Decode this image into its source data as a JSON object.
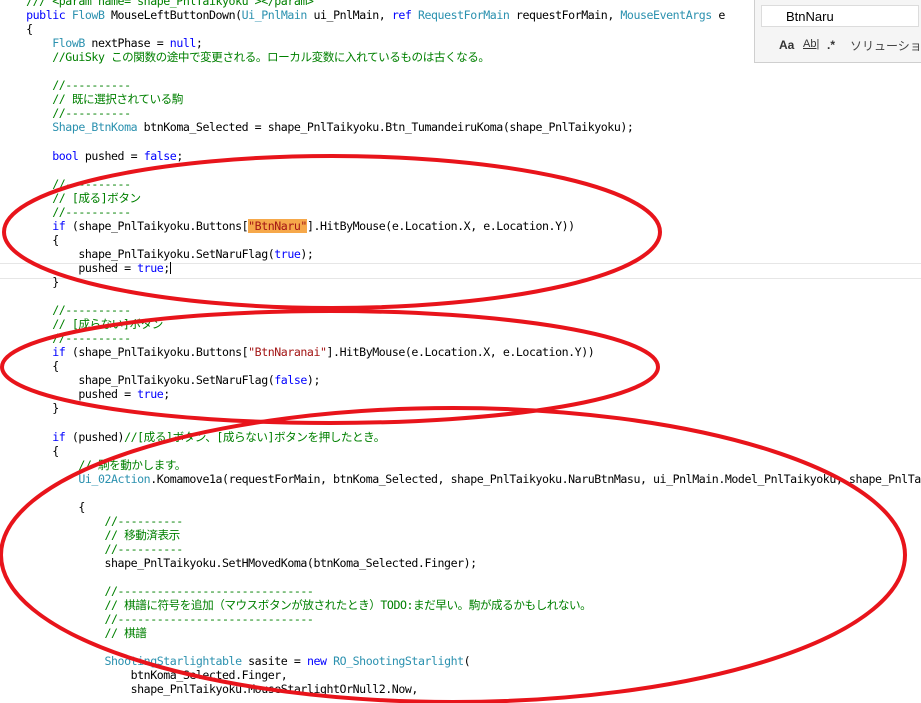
{
  "editor": {
    "lines": [
      [
        {
          "t": "    /// <param name=\"shape_PnlTaikyoku\"></param>",
          "c": "comment"
        }
      ],
      [
        {
          "t": "    ",
          "c": "plain"
        },
        {
          "t": "public",
          "c": "kw"
        },
        {
          "t": " ",
          "c": "plain"
        },
        {
          "t": "FlowB",
          "c": "type"
        },
        {
          "t": " MouseLeftButtonDown(",
          "c": "plain"
        },
        {
          "t": "Ui_PnlMain",
          "c": "type"
        },
        {
          "t": " ui_PnlMain, ",
          "c": "plain"
        },
        {
          "t": "ref",
          "c": "kw"
        },
        {
          "t": " ",
          "c": "plain"
        },
        {
          "t": "RequestForMain",
          "c": "type"
        },
        {
          "t": " requestForMain, ",
          "c": "plain"
        },
        {
          "t": "MouseEventArgs",
          "c": "type"
        },
        {
          "t": " e",
          "c": "plain"
        }
      ],
      [
        {
          "t": "    {",
          "c": "plain"
        }
      ],
      [
        {
          "t": "        ",
          "c": "plain"
        },
        {
          "t": "FlowB",
          "c": "type"
        },
        {
          "t": " nextPhase = ",
          "c": "plain"
        },
        {
          "t": "null",
          "c": "kw"
        },
        {
          "t": ";",
          "c": "plain"
        }
      ],
      [
        {
          "t": "        //GuiSky この関数の途中で変更される。ローカル変数に入れているものは古くなる。",
          "c": "comment"
        }
      ],
      [],
      [
        {
          "t": "        //----------",
          "c": "comment"
        }
      ],
      [
        {
          "t": "        // 既に選択されている駒",
          "c": "comment"
        }
      ],
      [
        {
          "t": "        //----------",
          "c": "comment"
        }
      ],
      [
        {
          "t": "        ",
          "c": "plain"
        },
        {
          "t": "Shape_BtnKoma",
          "c": "type"
        },
        {
          "t": " btnKoma_Selected = shape_PnlTaikyoku.Btn_TumandeiruKoma(shape_PnlTaikyoku);",
          "c": "plain"
        }
      ],
      [],
      [
        {
          "t": "        ",
          "c": "plain"
        },
        {
          "t": "bool",
          "c": "kw"
        },
        {
          "t": " pushed = ",
          "c": "plain"
        },
        {
          "t": "false",
          "c": "kw"
        },
        {
          "t": ";",
          "c": "plain"
        }
      ],
      [],
      [
        {
          "t": "        //----------",
          "c": "comment"
        }
      ],
      [
        {
          "t": "        // [成る]ボタン",
          "c": "comment"
        }
      ],
      [
        {
          "t": "        //----------",
          "c": "comment"
        }
      ],
      [
        {
          "t": "        ",
          "c": "plain"
        },
        {
          "t": "if",
          "c": "kw"
        },
        {
          "t": " (shape_PnlTaikyoku.Buttons[",
          "c": "plain"
        },
        {
          "t": "\"BtnNaru\"",
          "c": "hl"
        },
        {
          "t": "].HitByMouse(e.Location.X, e.Location.Y))",
          "c": "plain"
        }
      ],
      [
        {
          "t": "        {",
          "c": "plain"
        }
      ],
      [
        {
          "t": "            shape_PnlTaikyoku.SetNaruFlag(",
          "c": "plain"
        },
        {
          "t": "true",
          "c": "kw"
        },
        {
          "t": ");",
          "c": "plain"
        }
      ],
      [
        {
          "t": "            pushed = ",
          "c": "plain"
        },
        {
          "t": "true",
          "c": "kw"
        },
        {
          "t": ";",
          "c": "plain"
        },
        {
          "t": "",
          "c": "caret"
        }
      ],
      [
        {
          "t": "        }",
          "c": "plain"
        }
      ],
      [],
      [
        {
          "t": "        //----------",
          "c": "comment"
        }
      ],
      [
        {
          "t": "        // [成らない]ボタン",
          "c": "comment"
        }
      ],
      [
        {
          "t": "        //----------",
          "c": "comment"
        }
      ],
      [
        {
          "t": "        ",
          "c": "plain"
        },
        {
          "t": "if",
          "c": "kw"
        },
        {
          "t": " (shape_PnlTaikyoku.Buttons[",
          "c": "plain"
        },
        {
          "t": "\"BtnNaranai\"",
          "c": "string"
        },
        {
          "t": "].HitByMouse(e.Location.X, e.Location.Y))",
          "c": "plain"
        }
      ],
      [
        {
          "t": "        {",
          "c": "plain"
        }
      ],
      [
        {
          "t": "            shape_PnlTaikyoku.SetNaruFlag(",
          "c": "plain"
        },
        {
          "t": "false",
          "c": "kw"
        },
        {
          "t": ");",
          "c": "plain"
        }
      ],
      [
        {
          "t": "            pushed = ",
          "c": "plain"
        },
        {
          "t": "true",
          "c": "kw"
        },
        {
          "t": ";",
          "c": "plain"
        }
      ],
      [
        {
          "t": "        }",
          "c": "plain"
        }
      ],
      [],
      [
        {
          "t": "        ",
          "c": "plain"
        },
        {
          "t": "if",
          "c": "kw"
        },
        {
          "t": " (pushed)",
          "c": "plain"
        },
        {
          "t": "//[成る]ボタン、[成らない]ボタンを押したとき。",
          "c": "comment"
        }
      ],
      [
        {
          "t": "        {",
          "c": "plain"
        }
      ],
      [
        {
          "t": "            ",
          "c": "plain"
        },
        {
          "t": "// 駒を動かします。",
          "c": "comment"
        }
      ],
      [
        {
          "t": "            ",
          "c": "plain"
        },
        {
          "t": "Ui_02Action",
          "c": "type"
        },
        {
          "t": ".Komamove1a(requestForMain, btnKoma_Selected, shape_PnlTaikyoku.NaruBtnMasu, ui_PnlMain.Model_PnlTaikyoku, shape_PnlTaikyoku",
          "c": "plain"
        }
      ],
      [],
      [
        {
          "t": "            {",
          "c": "plain"
        }
      ],
      [
        {
          "t": "                //----------",
          "c": "comment"
        }
      ],
      [
        {
          "t": "                // 移動済表示",
          "c": "comment"
        }
      ],
      [
        {
          "t": "                //----------",
          "c": "comment"
        }
      ],
      [
        {
          "t": "                shape_PnlTaikyoku.SetHMovedKoma(btnKoma_Selected.Finger);",
          "c": "plain"
        }
      ],
      [],
      [
        {
          "t": "                //------------------------------",
          "c": "comment"
        }
      ],
      [
        {
          "t": "                // 棋譜に符号を追加（マウスボタンが放されたとき）TODO:まだ早い。駒が成るかもしれない。",
          "c": "comment"
        }
      ],
      [
        {
          "t": "                //------------------------------",
          "c": "comment"
        }
      ],
      [
        {
          "t": "                // 棋譜",
          "c": "comment"
        }
      ],
      [],
      [
        {
          "t": "                ",
          "c": "plain"
        },
        {
          "t": "ShootingStarlightable",
          "c": "type"
        },
        {
          "t": " sasite = ",
          "c": "plain"
        },
        {
          "t": "new",
          "c": "kw"
        },
        {
          "t": " ",
          "c": "plain"
        },
        {
          "t": "RO_ShootingStarlight",
          "c": "type"
        },
        {
          "t": "(",
          "c": "plain"
        }
      ],
      [
        {
          "t": "                    btnKoma_Selected.Finger,",
          "c": "plain"
        }
      ],
      [
        {
          "t": "                    shape_PnlTaikyoku.MouseStarlightOrNull2.Now,",
          "c": "plain"
        }
      ]
    ]
  },
  "find": {
    "query": "BtnNaru",
    "option_match_case": "Aa",
    "option_whole_word": "Ab|",
    "option_regex": ".*",
    "scope_label": "ソリューション"
  },
  "colors": {
    "keyword": "#0000ff",
    "type": "#2b91af",
    "comment": "#008000",
    "string": "#a31515",
    "find_highlight": "#f6a84a",
    "annotation": "#e8141b"
  }
}
